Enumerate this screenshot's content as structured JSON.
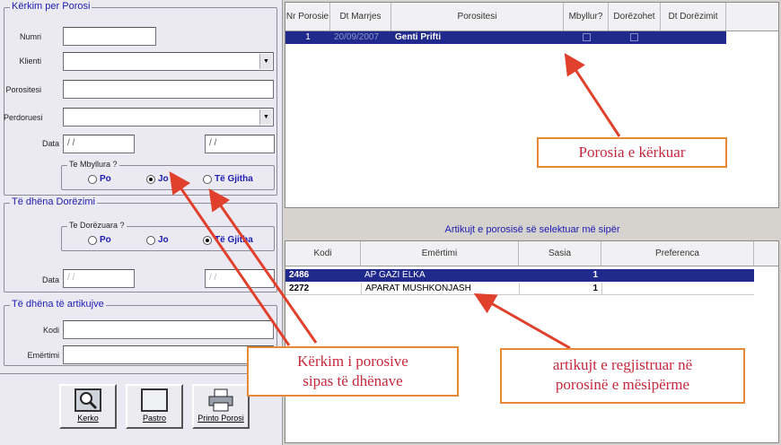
{
  "search": {
    "group_title": "Kërkim per Porosi",
    "nr_label": "Numri",
    "client_label": "Klienti",
    "orderer_label": "Porositesi",
    "user_label": "Perdoruesi",
    "date_label": "Data",
    "date_from": "/ /",
    "date_to": "/ /",
    "closed_group": "Te Mbyllura ?",
    "radio_po": "Po",
    "radio_jo": "Jo",
    "radio_all": "Të Gjitha"
  },
  "delivery": {
    "group_title": "Të dhëna Dorëzimi",
    "delivered_group": "Te Dorëzuara ?",
    "radio_po": "Po",
    "radio_jo": "Jo",
    "radio_all": "Të Gjitha",
    "date_label": "Data",
    "date_from": "/ /",
    "date_to": "/ /"
  },
  "articles_filter": {
    "group_title": "Të dhëna të artikujve",
    "code_label": "Kodi",
    "name_label": "Emërtimi"
  },
  "toolbar": {
    "search_label": "Kerko",
    "clear_label": "Pastro",
    "print_label": "Printo Porosi"
  },
  "orders_grid": {
    "headers": [
      "Nr Porosie",
      "Dt Marrjes",
      "Porositesi",
      "Mbyllur?",
      "Dorëzohet",
      "Dt Dorëzimit"
    ],
    "rows": [
      {
        "nr": "1",
        "date": "20/09/2007",
        "orderer": "Genti Prifti"
      }
    ]
  },
  "articles_caption": "Artikujt e porosisë së selektuar më sipër",
  "articles_grid": {
    "headers": [
      "Kodi",
      "Emërtimi",
      "Sasia",
      "Preferenca"
    ],
    "rows": [
      {
        "code": "2486",
        "name": "AP GAZI ELKA",
        "qty": "1",
        "pref": ""
      },
      {
        "code": "2272",
        "name": "APARAT MUSHKONJASH",
        "qty": "1",
        "pref": ""
      }
    ]
  },
  "callouts": {
    "order_found": "Porosia e kërkuar",
    "search_l1": "Kërkim i porosive",
    "search_l2": "sipas të dhënave",
    "articles_l1": "artikujt e regjistruar në",
    "articles_l2": "porosinë e mësipërme"
  },
  "colors": {
    "selection": "#1f2a8c",
    "group_title": "#1c1cb2",
    "callout_text": "#c8283c",
    "callout_border": "#e8893a",
    "arrow": "#e0402c"
  }
}
